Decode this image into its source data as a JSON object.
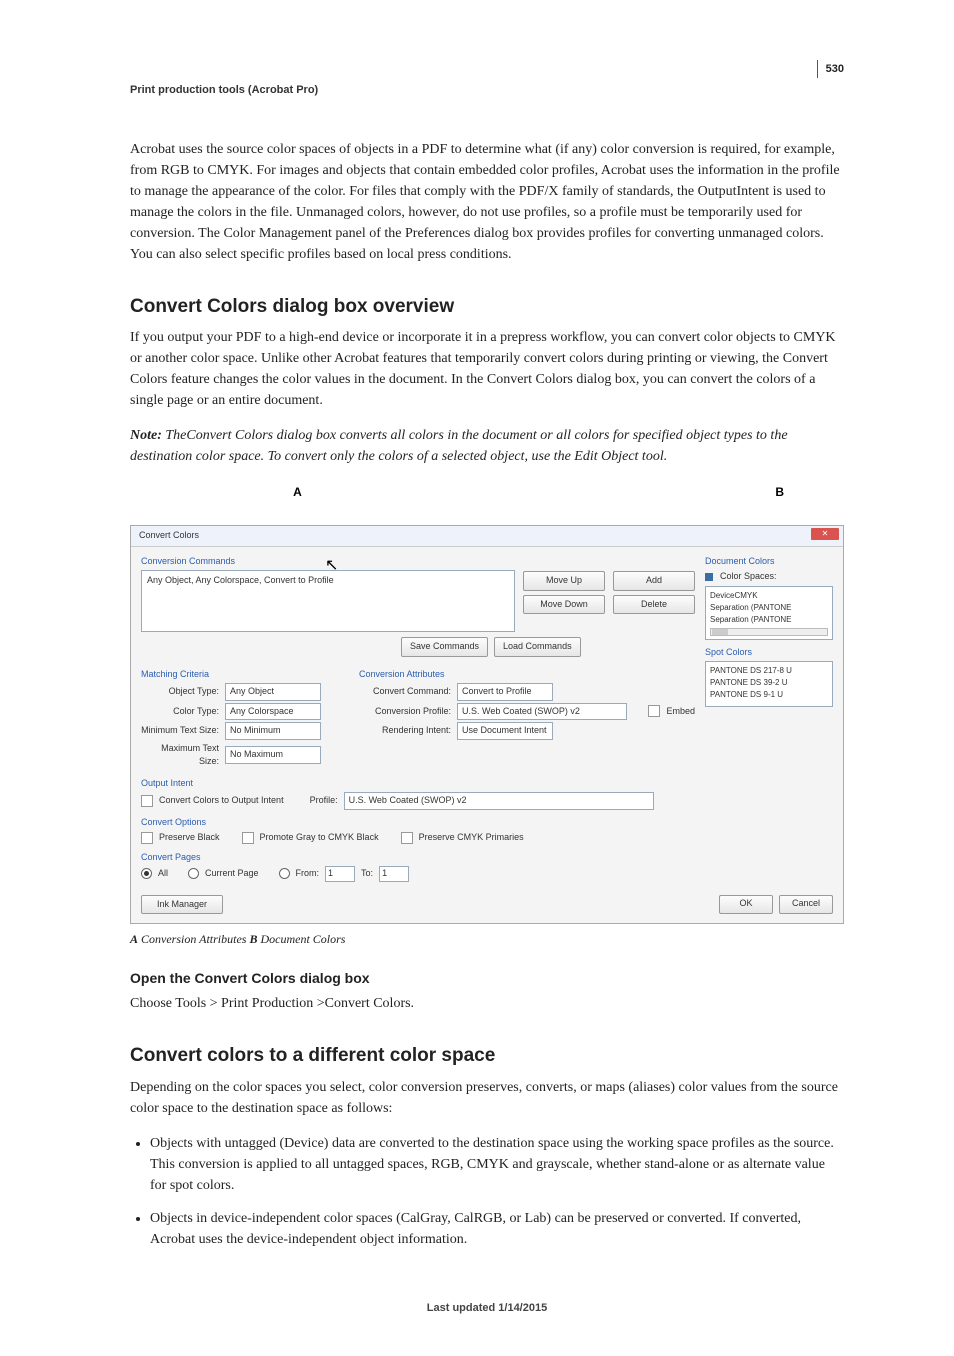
{
  "page_number": "530",
  "header": "Print production tools (Acrobat Pro)",
  "intro_para": "Acrobat uses the source color spaces of objects in a PDF to determine what (if any) color conversion is required, for example, from RGB to CMYK. For images and objects that contain embedded color profiles, Acrobat uses the information in the profile to manage the appearance of the color. For files that comply with the PDF/X family of standards, the OutputIntent is used to manage the colors in the file. Unmanaged colors, however, do not use profiles, so a profile must be temporarily used for conversion. The Color Management panel of the Preferences dialog box provides profiles for converting unmanaged colors. You can also select specific profiles based on local press conditions.",
  "h2_1": "Convert Colors dialog box overview",
  "para_2": "If you output your PDF to a high-end device or incorporate it in a prepress workflow, you can convert color objects to CMYK or another color space. Unlike other Acrobat features that temporarily convert colors during printing or viewing, the Convert Colors feature changes the color values in the document. In the Convert Colors dialog box, you can convert the colors of a single page or an entire document.",
  "note_label": "Note:",
  "note_text": " TheConvert Colors dialog box converts all colors in the document or all colors for specified object types to the destination color space. To convert only the colors of a selected object, use the Edit Object tool.",
  "callout_A": "A",
  "callout_B": "B",
  "caption_A_label": "A",
  "caption_A_text": " Conversion Attributes  ",
  "caption_B_label": "B",
  "caption_B_text": " Document Colors",
  "dlg": {
    "title": "Convert Colors",
    "conv_cmds_label": "Conversion Commands",
    "cmd_item": "Any Object, Any Colorspace, Convert to Profile",
    "btn_move_up": "Move Up",
    "btn_move_down": "Move Down",
    "btn_add": "Add",
    "btn_delete": "Delete",
    "btn_save_cmds": "Save Commands",
    "btn_load_cmds": "Load Commands",
    "matching_label": "Matching Criteria",
    "object_type_label": "Object Type:",
    "object_type_value": "Any Object",
    "color_type_label": "Color Type:",
    "color_type_value": "Any Colorspace",
    "min_text_label": "Minimum Text Size:",
    "min_text_value": "No Minimum",
    "max_text_label": "Maximum Text Size:",
    "max_text_value": "No Maximum",
    "conv_attr_label": "Conversion Attributes",
    "conv_cmd_label": "Convert Command:",
    "conv_cmd_value": "Convert to Profile",
    "conv_profile_label": "Conversion Profile:",
    "conv_profile_value": "U.S. Web Coated (SWOP) v2",
    "embed_label": "Embed",
    "render_intent_label": "Rendering Intent:",
    "render_intent_value": "Use Document Intent",
    "output_intent_label": "Output Intent",
    "convert_colors_oi_label": "Convert Colors to Output Intent",
    "profile_label": "Profile:",
    "profile_value": "U.S. Web Coated (SWOP) v2",
    "convert_options_label": "Convert Options",
    "preserve_black": "Preserve Black",
    "promote_gray": "Promote Gray to CMYK Black",
    "preserve_cmyk_prim": "Preserve CMYK Primaries",
    "convert_pages_label": "Convert Pages",
    "radio_all": "All",
    "radio_current": "Current Page",
    "radio_from": "From:",
    "from_val": "1",
    "to_label": "To:",
    "to_val": "1",
    "ink_manager": "Ink Manager",
    "ok": "OK",
    "cancel": "Cancel",
    "doc_colors_label": "Document Colors",
    "color_spaces_label": "Color Spaces:",
    "cs_item1": "DeviceCMYK",
    "cs_item2": "Separation (PANTONE",
    "cs_item3": "Separation (PANTONE",
    "spot_colors_label": "Spot Colors",
    "sc_item1": "PANTONE DS 217-8 U",
    "sc_item2": "PANTONE DS 39-2 U",
    "sc_item3": "PANTONE DS 9-1 U"
  },
  "h3_open": "Open the Convert Colors dialog box",
  "open_para": "Choose Tools > Print Production >Convert Colors.",
  "h2_2": "Convert colors to a different color space",
  "para_3": "Depending on the color spaces you select, color conversion preserves, converts, or maps (aliases) color values from the source color space to the destination space as follows:",
  "bullet_1": "Objects with untagged (Device) data are converted to the destination space using the working space profiles as the source. This conversion is applied to all untagged spaces, RGB, CMYK and grayscale, whether stand-alone or as alternate value for spot colors.",
  "bullet_2": "Objects in device-independent color spaces (CalGray, CalRGB, or Lab) can be preserved or converted. If converted, Acrobat uses the device-independent object information.",
  "footer": "Last updated 1/14/2015"
}
